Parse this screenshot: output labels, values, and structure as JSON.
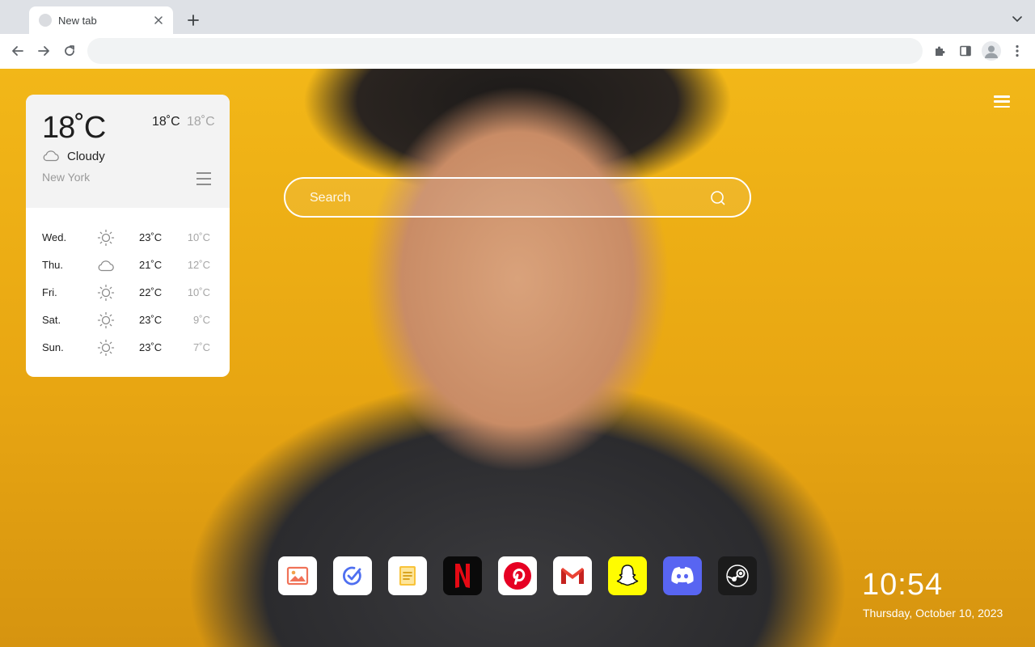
{
  "browser": {
    "tab_title": "New tab",
    "address_value": ""
  },
  "weather": {
    "current_temp": "18˚C",
    "high": "18˚C",
    "low": "18˚C",
    "condition": "Cloudy",
    "city": "New York",
    "forecast": [
      {
        "day": "Wed.",
        "icon": "sun-icon",
        "high": "23˚C",
        "low": "10˚C"
      },
      {
        "day": "Thu.",
        "icon": "cloud-icon",
        "high": "21˚C",
        "low": "12˚C"
      },
      {
        "day": "Fri.",
        "icon": "sun-icon",
        "high": "22˚C",
        "low": "10˚C"
      },
      {
        "day": "Sat.",
        "icon": "sun-icon",
        "high": "23˚C",
        "low": "9˚C"
      },
      {
        "day": "Sun.",
        "icon": "sun-icon",
        "high": "23˚C",
        "low": "7˚C"
      }
    ]
  },
  "search": {
    "placeholder": "Search"
  },
  "dock": [
    {
      "name": "photos-app",
      "icon": "photo-icon"
    },
    {
      "name": "tasks-app",
      "icon": "check-circle-icon"
    },
    {
      "name": "notes-app",
      "icon": "note-icon"
    },
    {
      "name": "netflix-app",
      "icon": "netflix-icon"
    },
    {
      "name": "pinterest-app",
      "icon": "pinterest-icon"
    },
    {
      "name": "gmail-app",
      "icon": "gmail-icon"
    },
    {
      "name": "snapchat-app",
      "icon": "snapchat-icon"
    },
    {
      "name": "discord-app",
      "icon": "discord-icon"
    },
    {
      "name": "steam-app",
      "icon": "steam-icon"
    }
  ],
  "clock": {
    "time": "10:54",
    "date": "Thursday, October 10, 2023"
  }
}
